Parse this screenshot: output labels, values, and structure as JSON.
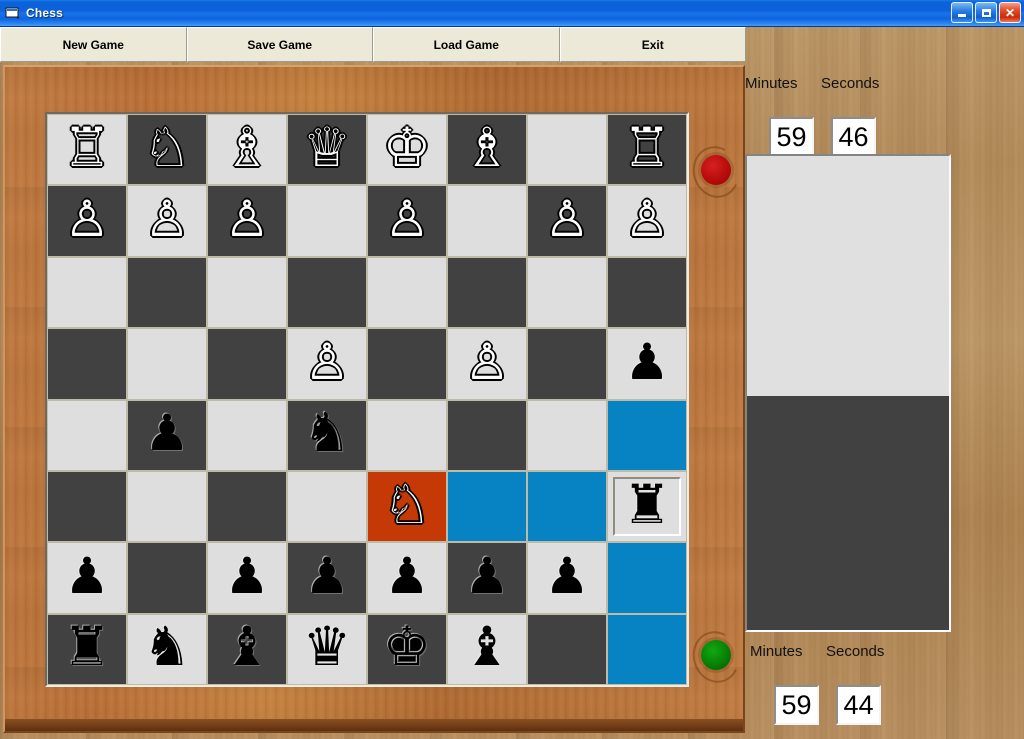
{
  "window": {
    "title": "Chess",
    "icon": "app-window-icon",
    "controls": [
      {
        "name": "minimize",
        "glyph": "_"
      },
      {
        "name": "restore",
        "glyph": "❐"
      },
      {
        "name": "close",
        "glyph": "×"
      }
    ]
  },
  "toolbar": {
    "buttons": [
      {
        "id": "new-game",
        "label": "New Game"
      },
      {
        "id": "save-game",
        "label": "Save Game"
      },
      {
        "id": "load-game",
        "label": "Load Game"
      },
      {
        "id": "exit",
        "label": "Exit"
      }
    ]
  },
  "clocks": {
    "top": {
      "minutes_label": "Minutes",
      "seconds_label": "Seconds",
      "minutes": "59",
      "seconds": "46",
      "indicator": "red"
    },
    "bottom": {
      "minutes_label": "Minutes",
      "seconds_label": "Seconds",
      "minutes": "59",
      "seconds": "44",
      "indicator": "green"
    }
  },
  "colors": {
    "light_square": "#dedede",
    "dark_square": "#414141",
    "highlight_move": "#0782c2",
    "highlight_selected": "#c43906",
    "titlebar": "#0d62dc",
    "toolbar_face": "#ece9d8",
    "wood_frame": "#b96f37",
    "indicator_red": "#b90c0c",
    "indicator_green": "#068006"
  },
  "capture_panel": {
    "white_tray_label": "",
    "black_tray_label": ""
  },
  "board": {
    "rows": 8,
    "cols": 8,
    "squares": [
      [
        {
          "sq": "a8",
          "shade": "light",
          "piece": "rook",
          "color": "w",
          "state": "none"
        },
        {
          "sq": "b8",
          "shade": "dark",
          "piece": "knight",
          "color": "w",
          "state": "none"
        },
        {
          "sq": "c8",
          "shade": "light",
          "piece": "bishop",
          "color": "w",
          "state": "none"
        },
        {
          "sq": "d8",
          "shade": "dark",
          "piece": "queen",
          "color": "w",
          "state": "none"
        },
        {
          "sq": "e8",
          "shade": "light",
          "piece": "king",
          "color": "w",
          "state": "none"
        },
        {
          "sq": "f8",
          "shade": "dark",
          "piece": "bishop",
          "color": "w",
          "state": "none"
        },
        {
          "sq": "g8",
          "shade": "light",
          "piece": null,
          "color": null,
          "state": "none"
        },
        {
          "sq": "h8",
          "shade": "dark",
          "piece": "rook",
          "color": "w",
          "state": "none"
        }
      ],
      [
        {
          "sq": "a7",
          "shade": "dark",
          "piece": "pawn",
          "color": "w",
          "state": "none"
        },
        {
          "sq": "b7",
          "shade": "light",
          "piece": "pawn",
          "color": "w",
          "state": "none"
        },
        {
          "sq": "c7",
          "shade": "dark",
          "piece": "pawn",
          "color": "w",
          "state": "none"
        },
        {
          "sq": "d7",
          "shade": "light",
          "piece": null,
          "color": null,
          "state": "none"
        },
        {
          "sq": "e7",
          "shade": "dark",
          "piece": "pawn",
          "color": "w",
          "state": "none"
        },
        {
          "sq": "f7",
          "shade": "light",
          "piece": null,
          "color": null,
          "state": "none"
        },
        {
          "sq": "g7",
          "shade": "dark",
          "piece": "pawn",
          "color": "w",
          "state": "none"
        },
        {
          "sq": "h7",
          "shade": "light",
          "piece": "pawn",
          "color": "w",
          "state": "none"
        }
      ],
      [
        {
          "sq": "a6",
          "shade": "light",
          "piece": null,
          "color": null,
          "state": "none"
        },
        {
          "sq": "b6",
          "shade": "dark",
          "piece": null,
          "color": null,
          "state": "none"
        },
        {
          "sq": "c6",
          "shade": "light",
          "piece": null,
          "color": null,
          "state": "none"
        },
        {
          "sq": "d6",
          "shade": "dark",
          "piece": null,
          "color": null,
          "state": "none"
        },
        {
          "sq": "e6",
          "shade": "light",
          "piece": null,
          "color": null,
          "state": "none"
        },
        {
          "sq": "f6",
          "shade": "dark",
          "piece": null,
          "color": null,
          "state": "none"
        },
        {
          "sq": "g6",
          "shade": "light",
          "piece": null,
          "color": null,
          "state": "none"
        },
        {
          "sq": "h6",
          "shade": "dark",
          "piece": null,
          "color": null,
          "state": "none"
        }
      ],
      [
        {
          "sq": "a5",
          "shade": "dark",
          "piece": null,
          "color": null,
          "state": "none"
        },
        {
          "sq": "b5",
          "shade": "light",
          "piece": null,
          "color": null,
          "state": "none"
        },
        {
          "sq": "c5",
          "shade": "dark",
          "piece": null,
          "color": null,
          "state": "none"
        },
        {
          "sq": "d5",
          "shade": "light",
          "piece": "pawn",
          "color": "w",
          "state": "none"
        },
        {
          "sq": "e5",
          "shade": "dark",
          "piece": null,
          "color": null,
          "state": "none"
        },
        {
          "sq": "f5",
          "shade": "light",
          "piece": "pawn",
          "color": "w",
          "state": "none"
        },
        {
          "sq": "g5",
          "shade": "dark",
          "piece": null,
          "color": null,
          "state": "none"
        },
        {
          "sq": "h5",
          "shade": "light",
          "piece": "pawn",
          "color": "b",
          "state": "none"
        }
      ],
      [
        {
          "sq": "a4",
          "shade": "light",
          "piece": null,
          "color": null,
          "state": "none"
        },
        {
          "sq": "b4",
          "shade": "dark",
          "piece": "pawn",
          "color": "b",
          "state": "none"
        },
        {
          "sq": "c4",
          "shade": "light",
          "piece": null,
          "color": null,
          "state": "none"
        },
        {
          "sq": "d4",
          "shade": "dark",
          "piece": "knight",
          "color": "b",
          "state": "none"
        },
        {
          "sq": "e4",
          "shade": "light",
          "piece": null,
          "color": null,
          "state": "none"
        },
        {
          "sq": "f4",
          "shade": "dark",
          "piece": null,
          "color": null,
          "state": "none"
        },
        {
          "sq": "g4",
          "shade": "light",
          "piece": null,
          "color": null,
          "state": "none"
        },
        {
          "sq": "h4",
          "shade": "dark",
          "piece": null,
          "color": null,
          "state": "move"
        }
      ],
      [
        {
          "sq": "a3",
          "shade": "dark",
          "piece": null,
          "color": null,
          "state": "none"
        },
        {
          "sq": "b3",
          "shade": "light",
          "piece": null,
          "color": null,
          "state": "none"
        },
        {
          "sq": "c3",
          "shade": "dark",
          "piece": null,
          "color": null,
          "state": "none"
        },
        {
          "sq": "d3",
          "shade": "light",
          "piece": null,
          "color": null,
          "state": "none"
        },
        {
          "sq": "e3",
          "shade": "dark",
          "piece": "knight",
          "color": "w",
          "state": "selected"
        },
        {
          "sq": "f3",
          "shade": "light",
          "piece": null,
          "color": null,
          "state": "move"
        },
        {
          "sq": "g3",
          "shade": "dark",
          "piece": null,
          "color": null,
          "state": "move"
        },
        {
          "sq": "h3",
          "shade": "light",
          "piece": "rook",
          "color": "b",
          "state": "picked"
        }
      ],
      [
        {
          "sq": "a2",
          "shade": "light",
          "piece": "pawn",
          "color": "b",
          "state": "none"
        },
        {
          "sq": "b2",
          "shade": "dark",
          "piece": null,
          "color": null,
          "state": "none"
        },
        {
          "sq": "c2",
          "shade": "light",
          "piece": "pawn",
          "color": "b",
          "state": "none"
        },
        {
          "sq": "d2",
          "shade": "dark",
          "piece": "pawn",
          "color": "b",
          "state": "none"
        },
        {
          "sq": "e2",
          "shade": "light",
          "piece": "pawn",
          "color": "b",
          "state": "none"
        },
        {
          "sq": "f2",
          "shade": "dark",
          "piece": "pawn",
          "color": "b",
          "state": "none"
        },
        {
          "sq": "g2",
          "shade": "light",
          "piece": "pawn",
          "color": "b",
          "state": "none"
        },
        {
          "sq": "h2",
          "shade": "dark",
          "piece": null,
          "color": null,
          "state": "move"
        }
      ],
      [
        {
          "sq": "a1",
          "shade": "dark",
          "piece": "rook",
          "color": "b",
          "state": "none"
        },
        {
          "sq": "b1",
          "shade": "light",
          "piece": "knight",
          "color": "b",
          "state": "none"
        },
        {
          "sq": "c1",
          "shade": "dark",
          "piece": "bishop",
          "color": "b",
          "state": "none"
        },
        {
          "sq": "d1",
          "shade": "light",
          "piece": "queen",
          "color": "b",
          "state": "none"
        },
        {
          "sq": "e1",
          "shade": "dark",
          "piece": "king",
          "color": "b",
          "state": "none"
        },
        {
          "sq": "f1",
          "shade": "light",
          "piece": "bishop",
          "color": "b",
          "state": "none"
        },
        {
          "sq": "g1",
          "shade": "dark",
          "piece": null,
          "color": null,
          "state": "none"
        },
        {
          "sq": "h1",
          "shade": "light",
          "piece": null,
          "color": null,
          "state": "move"
        }
      ]
    ]
  }
}
